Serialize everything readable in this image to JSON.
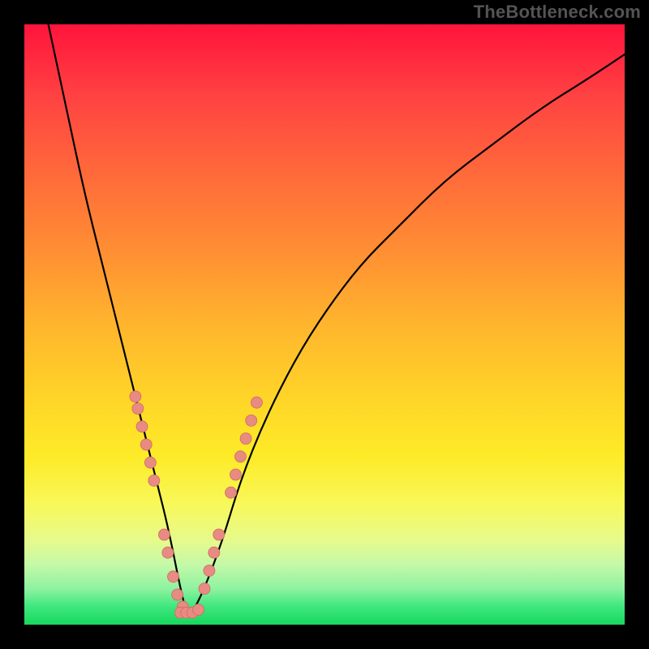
{
  "watermark": "TheBottleneck.com",
  "colors": {
    "frame": "#000000",
    "curve": "#000000",
    "dot_fill": "#e88b82",
    "dot_stroke": "#d06a60"
  },
  "chart_data": {
    "type": "line",
    "title": "",
    "xlabel": "",
    "ylabel": "",
    "xlim": [
      0,
      100
    ],
    "ylim": [
      0,
      100
    ],
    "x_at_min": 27,
    "series": [
      {
        "name": "bottleneck-curve",
        "x": [
          4,
          7,
          10,
          13,
          16,
          18,
          20,
          22,
          24,
          26,
          27,
          28,
          30,
          33,
          36,
          40,
          45,
          50,
          56,
          62,
          70,
          78,
          86,
          94,
          100
        ],
        "values": [
          100,
          86,
          72,
          60,
          48,
          40,
          32,
          24,
          16,
          6,
          2,
          2,
          6,
          14,
          24,
          34,
          44,
          52,
          60,
          66,
          74,
          80,
          86,
          91,
          95
        ]
      }
    ],
    "points_left": [
      {
        "x": 18.5,
        "y": 38
      },
      {
        "x": 18.9,
        "y": 36
      },
      {
        "x": 19.6,
        "y": 33
      },
      {
        "x": 20.3,
        "y": 30
      },
      {
        "x": 21.0,
        "y": 27
      },
      {
        "x": 21.6,
        "y": 24
      },
      {
        "x": 23.3,
        "y": 15
      },
      {
        "x": 23.9,
        "y": 12
      },
      {
        "x": 24.8,
        "y": 8
      },
      {
        "x": 25.5,
        "y": 5
      },
      {
        "x": 26.4,
        "y": 3
      }
    ],
    "points_min": [
      {
        "x": 26.0,
        "y": 2
      },
      {
        "x": 27.0,
        "y": 2
      },
      {
        "x": 28.0,
        "y": 2
      },
      {
        "x": 29.0,
        "y": 2.5
      }
    ],
    "points_right": [
      {
        "x": 30.0,
        "y": 6
      },
      {
        "x": 30.8,
        "y": 9
      },
      {
        "x": 31.6,
        "y": 12
      },
      {
        "x": 32.4,
        "y": 15
      },
      {
        "x": 34.4,
        "y": 22
      },
      {
        "x": 35.2,
        "y": 25
      },
      {
        "x": 36.0,
        "y": 28
      },
      {
        "x": 36.9,
        "y": 31
      },
      {
        "x": 37.8,
        "y": 34
      },
      {
        "x": 38.7,
        "y": 37
      }
    ]
  }
}
